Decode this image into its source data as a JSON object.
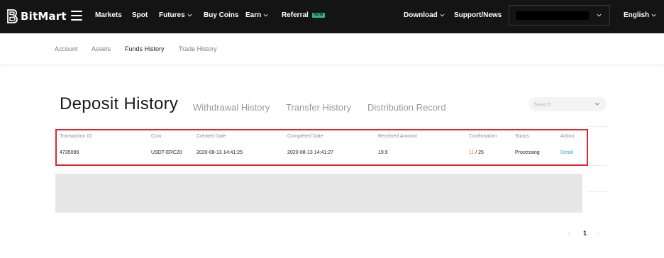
{
  "brand": {
    "name": "BitMart"
  },
  "topnav": {
    "items": [
      {
        "label": "Markets",
        "has_dropdown": false
      },
      {
        "label": "Spot",
        "has_dropdown": false
      },
      {
        "label": "Futures",
        "has_dropdown": true
      },
      {
        "label": "Buy Coins",
        "has_dropdown": false
      },
      {
        "label": "Earn",
        "has_dropdown": true
      },
      {
        "label": "Referral",
        "has_dropdown": false,
        "badge": "NEW"
      }
    ],
    "right": {
      "download": "Download",
      "support": "Support/News",
      "language": "English"
    }
  },
  "subnav": {
    "items": [
      "Account",
      "Assets",
      "Funds History",
      "Trade History"
    ],
    "active": "Funds History"
  },
  "page": {
    "title": "Deposit History",
    "tabs": [
      "Withdrawal History",
      "Transfer History",
      "Distribution Record"
    ],
    "search_placeholder": "Search"
  },
  "table": {
    "columns": [
      "Transaction ID",
      "Coin",
      "Created Date",
      "Completed Date",
      "Received Amount",
      "Confirmation",
      "Status",
      "Action"
    ],
    "rows": [
      {
        "transaction_id": "4735099",
        "coin": "USDT-ERC20",
        "created_date": "2020-08-13 14:41:25",
        "completed_date": "2020-08-13 14:41:27",
        "received_amount": "19.9",
        "confirmation_current": "11",
        "confirmation_sep": " / ",
        "confirmation_total": "25",
        "status": "Processing",
        "action": "Detail"
      }
    ]
  },
  "pagination": {
    "current_page": "1",
    "prev": "‹",
    "next": "›"
  },
  "colors": {
    "topbar_bg": "#141414",
    "accent_link": "#2ca8c4",
    "confirmation_current": "#f0883c",
    "highlight_border": "#e2262c",
    "new_badge": "#2fb39b"
  }
}
